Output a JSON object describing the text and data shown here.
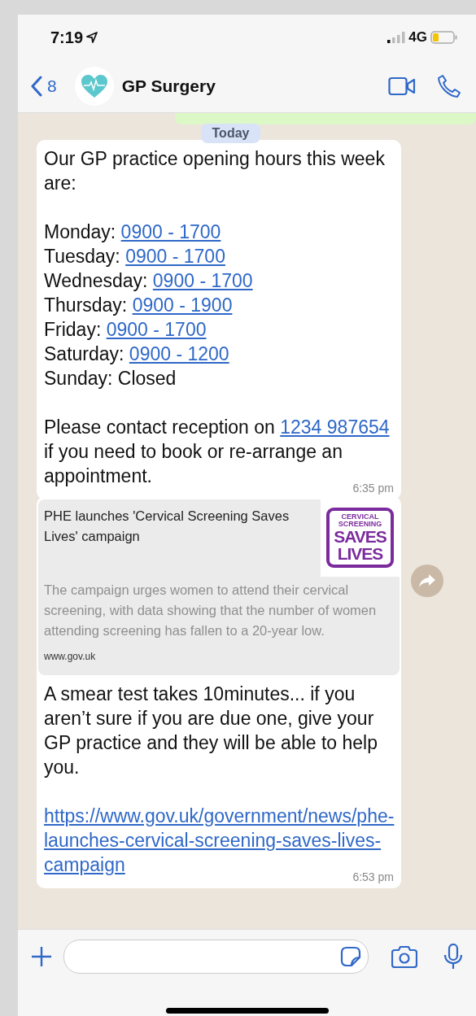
{
  "status_bar": {
    "time": "7:19",
    "network": "4G"
  },
  "header": {
    "back_count": "8",
    "title": "GP Surgery"
  },
  "date_chip": "Today",
  "messages": [
    {
      "kind": "hours",
      "intro": "Our GP practice opening hours this week are:",
      "hours": [
        {
          "day": "Monday:",
          "value": "0900 - 1700",
          "link": true
        },
        {
          "day": "Tuesday:",
          "value": "0900 - 1700",
          "link": true
        },
        {
          "day": "Wednesday:",
          "value": "0900 - 1700",
          "link": true
        },
        {
          "day": "Thursday:",
          "value": "0900 - 1900",
          "link": true
        },
        {
          "day": "Friday:",
          "value": "0900 - 1700",
          "link": true
        },
        {
          "day": "Saturday:",
          "value": "0900 - 1200",
          "link": true
        },
        {
          "day": "Sunday:",
          "value": "Closed",
          "link": false
        }
      ],
      "contact_before": "Please contact reception on",
      "contact_link": "1234 987654",
      "contact_after": "if you need to book or re-arrange an appointment.",
      "time": "6:35 pm"
    },
    {
      "kind": "link_preview",
      "preview": {
        "title": "PHE launches 'Cervical Screening Saves Lives' campaign",
        "description": "The campaign urges women to attend their cervical screening, with data showing that the number of women attending screening has fallen to a 20-year low.",
        "domain": "www.gov.uk",
        "logo_lines": [
          "CERVICAL",
          "SCREENING",
          "SAVES",
          "LIVES"
        ]
      },
      "text": "A smear test takes 10minutes... if you aren’t sure if you are due one, give your GP practice and they will be able to help you.",
      "url": "https://www.gov.uk/government/news/phe-launches-cervical-screening-saves-lives-campaign",
      "time": "6:53 pm"
    }
  ]
}
